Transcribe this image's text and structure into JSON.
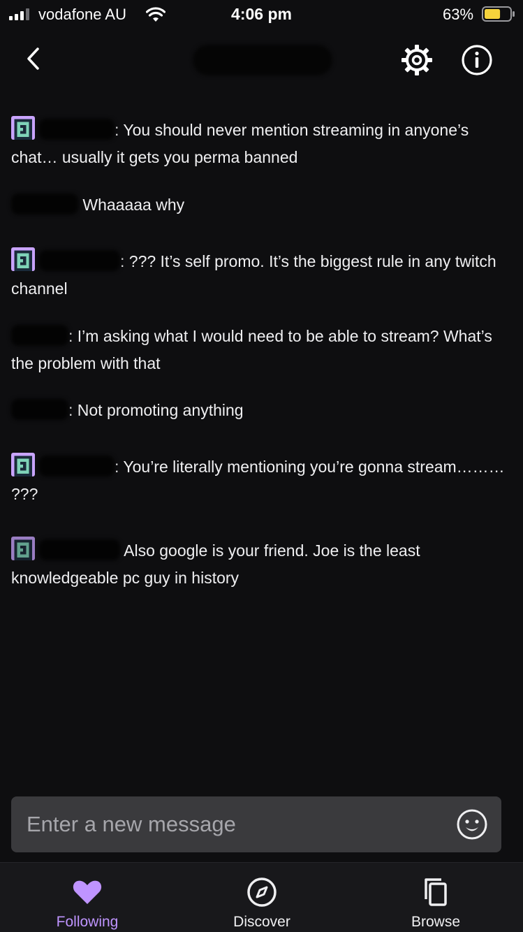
{
  "status_bar": {
    "carrier": "vodafone AU",
    "time": "4:06 pm",
    "battery_percent": "63%",
    "battery_level": 0.63
  },
  "header": {
    "back_icon": "chevron-left-icon",
    "settings_icon": "gear-icon",
    "info_icon": "info-icon"
  },
  "messages": [
    {
      "badge": "pixel-robot-badge",
      "text": "You should never mention streaming in anyone’s chat… usually it gets you perma banned"
    },
    {
      "badge": null,
      "text": "Whaaaaa why"
    },
    {
      "badge": "pixel-robot-badge",
      "text": "??? It’s self promo. It’s the biggest rule in any twitch channel"
    },
    {
      "badge": null,
      "text": "I’m asking what I would need to be able to stream? What’s the problem with that"
    },
    {
      "badge": null,
      "text": "Not promoting anything"
    },
    {
      "badge": "pixel-robot-badge",
      "text": "You’re literally mentioning you’re gonna stream……… ???"
    },
    {
      "badge": "pixel-robot-badge",
      "text": "Also google is your friend. Joe is the least knowledgeable pc guy in history"
    }
  ],
  "input": {
    "placeholder": "Enter a new message",
    "emote_icon": "smiley-face-icon"
  },
  "tabs": [
    {
      "label": "Following",
      "icon": "heart-icon",
      "active": true
    },
    {
      "label": "Discover",
      "icon": "compass-icon",
      "active": false
    },
    {
      "label": "Browse",
      "icon": "copy-stack-icon",
      "active": false
    }
  ],
  "colors": {
    "background": "#0e0e10",
    "accent": "#bf94ff",
    "input_bg": "#3a3a3d",
    "tab_bar_bg": "#18181b"
  }
}
